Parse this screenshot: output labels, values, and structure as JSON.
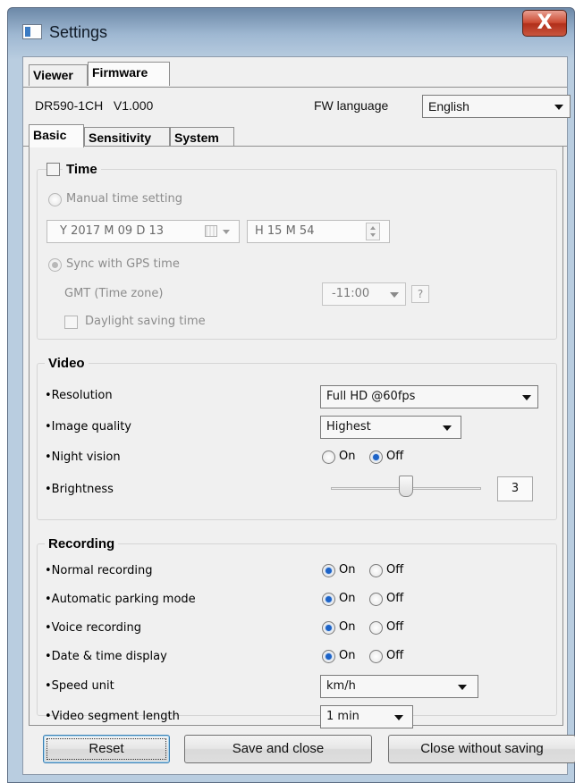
{
  "window": {
    "title": "Settings",
    "close_glyph": "X"
  },
  "top_tabs": [
    "Viewer",
    "Firmware"
  ],
  "firmware": {
    "model": "DR590-1CH",
    "version": "V1.000",
    "language_label": "FW language",
    "language_value": "English"
  },
  "sub_tabs": [
    "Basic",
    "Sensitivity",
    "System"
  ],
  "time": {
    "title": "Time",
    "manual_label": "Manual time setting",
    "date_value": "Y 2017 M 09 D 13",
    "time_value": "H 15 M 54",
    "gps_label": "Sync with GPS time",
    "gmt_label": "GMT (Time zone)",
    "gmt_value": "-11:00",
    "help_glyph": "?",
    "dst_label": "Daylight saving time"
  },
  "video": {
    "title": "Video",
    "resolution_label": "Resolution",
    "resolution_value": "Full HD @60fps",
    "quality_label": "Image quality",
    "quality_value": "Highest",
    "night_label": "Night vision",
    "on_label": "On",
    "off_label": "Off",
    "brightness_label": "Brightness",
    "brightness_value": "3",
    "brightness_level_fraction": 0.5
  },
  "recording": {
    "title": "Recording",
    "normal_label": "Normal recording",
    "parking_label": "Automatic parking mode",
    "voice_label": "Voice recording",
    "datetime_label": "Date & time display",
    "on_label": "On",
    "off_label": "Off",
    "speed_label": "Speed unit",
    "speed_value": "km/h",
    "segment_label": "Video segment length",
    "segment_value": "1 min"
  },
  "buttons": {
    "reset": "Reset",
    "save_close": "Save and close",
    "close_no_save": "Close without saving"
  }
}
